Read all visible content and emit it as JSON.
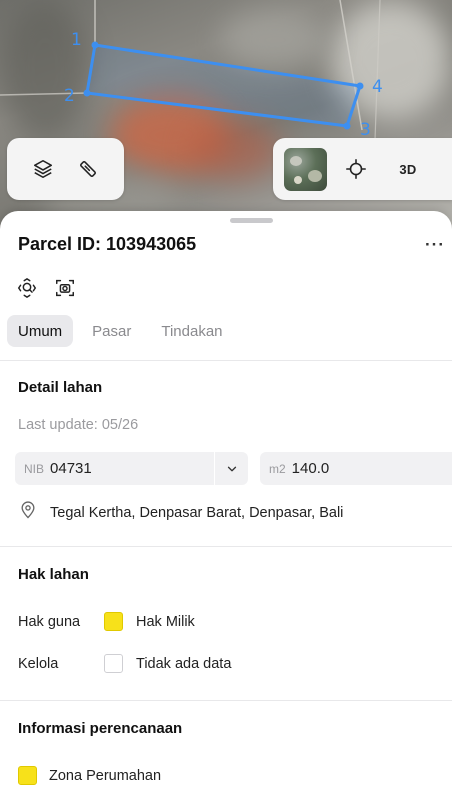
{
  "map": {
    "vertex_labels": [
      "1",
      "2",
      "3",
      "4"
    ],
    "controls": {
      "layers_icon": "layers-icon",
      "measure_icon": "measure-ruler-icon",
      "basemap_thumb": "satellite-thumbnail",
      "locate_icon": "crosshair-icon",
      "view_3d_label": "3D"
    },
    "parcel_color": "#3d8ff0"
  },
  "sheet": {
    "title": "Parcel ID: 103943065",
    "more_label": "···",
    "tools": [
      "zoom-to-parcel-icon",
      "screenshot-icon"
    ],
    "tabs": [
      {
        "label": "Umum",
        "active": true
      },
      {
        "label": "Pasar",
        "active": false
      },
      {
        "label": "Tindakan",
        "active": false
      }
    ],
    "detail": {
      "heading": "Detail lahan",
      "last_update": "Last update: 05/26",
      "nib_prefix": "NIB",
      "nib_value": "04731",
      "area_prefix": "m2",
      "area_value": "140.0",
      "address": "Tegal Kertha, Denpasar Barat, Denpasar, Bali"
    },
    "rights": {
      "heading": "Hak lahan",
      "rows": [
        {
          "label": "Hak guna",
          "value": "Hak Milik",
          "swatch": "yellow"
        },
        {
          "label": "Kelola",
          "value": "Tidak ada data",
          "swatch": "empty"
        }
      ]
    },
    "planning": {
      "heading": "Informasi perencanaan",
      "zone_label": "Zona Perumahan",
      "zone_color": "#f7e11a"
    }
  }
}
